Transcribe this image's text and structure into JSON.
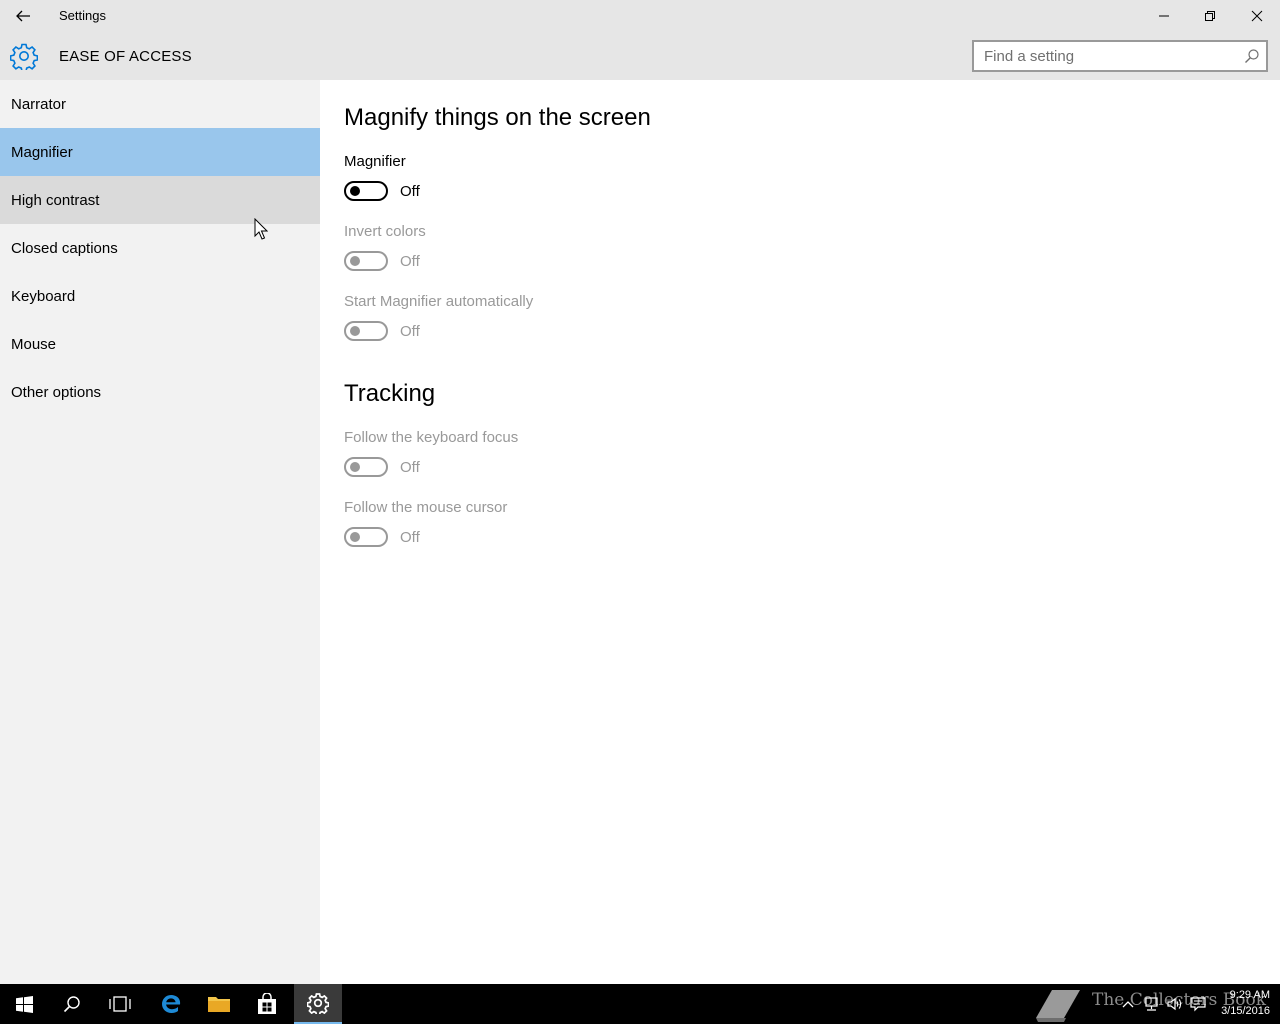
{
  "window": {
    "title": "Settings",
    "controls": [
      "minimize",
      "restore",
      "close"
    ]
  },
  "header": {
    "icon": "gear-icon",
    "title": "EASE OF ACCESS",
    "search_placeholder": "Find a setting"
  },
  "sidebar": {
    "items": [
      {
        "label": "Narrator",
        "state": "normal"
      },
      {
        "label": "Magnifier",
        "state": "selected"
      },
      {
        "label": "High contrast",
        "state": "hover"
      },
      {
        "label": "Closed captions",
        "state": "normal"
      },
      {
        "label": "Keyboard",
        "state": "normal"
      },
      {
        "label": "Mouse",
        "state": "normal"
      },
      {
        "label": "Other options",
        "state": "normal"
      }
    ]
  },
  "main": {
    "heading": "Magnify things on the screen",
    "magnifier": {
      "label": "Magnifier",
      "value": "Off"
    },
    "invert_colors": {
      "label": "Invert colors",
      "value": "Off"
    },
    "start_auto": {
      "label": "Start Magnifier automatically",
      "value": "Off"
    },
    "tracking_heading": "Tracking",
    "keyboard_focus": {
      "label": "Follow the keyboard focus",
      "value": "Off"
    },
    "mouse_cursor": {
      "label": "Follow the mouse cursor",
      "value": "Off"
    }
  },
  "taskbar": {
    "watermark": "The Collectors Book",
    "time": "9:29 AM",
    "date": "3/15/2016"
  },
  "colors": {
    "accent": "#0078d7",
    "selected_nav": "#99c6ec",
    "hover_nav": "#dadada",
    "sidebar_bg": "#f2f2f2",
    "titlebar_bg": "#e6e6e6"
  }
}
